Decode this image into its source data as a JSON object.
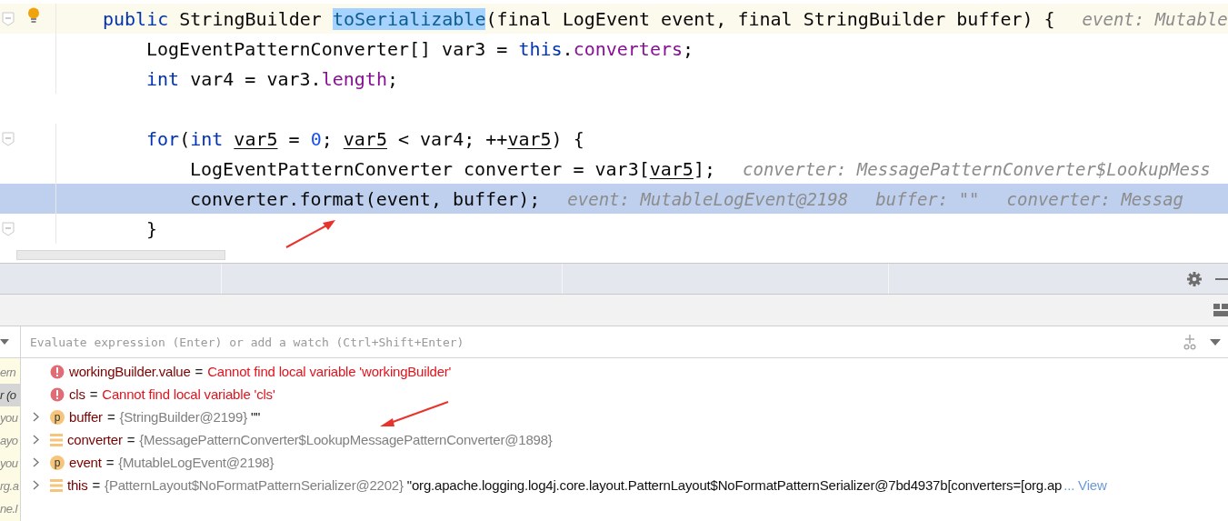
{
  "editor": {
    "lines": [
      {
        "fold": true,
        "bulb": true,
        "caret_line": true,
        "execution_point": false,
        "gap_before": false,
        "tokens": [
          {
            "text": "public",
            "kind": "keyword"
          },
          {
            "text": " StringBuilder ",
            "kind": "plain"
          },
          {
            "text": "toSerializable",
            "kind": "selection"
          },
          {
            "text": "(final LogEvent event, final StringBuilder buffer) {",
            "kind": "plain"
          }
        ],
        "hints": [
          "event: Mutable"
        ],
        "children": [
          {
            "fold": false,
            "bulb": false,
            "caret_line": false,
            "execution_point": false,
            "gap_before": false,
            "tokens": [
              {
                "text": "LogEventPatternConverter[] var3 = ",
                "kind": "plain"
              },
              {
                "text": "this",
                "kind": "keyword"
              },
              {
                "text": ".",
                "kind": "plain"
              },
              {
                "text": "converters",
                "kind": "field"
              },
              {
                "text": ";",
                "kind": "plain"
              }
            ]
          },
          {
            "fold": false,
            "bulb": false,
            "caret_line": false,
            "execution_point": false,
            "gap_before": false,
            "tokens": [
              {
                "text": "int",
                "kind": "keyword"
              },
              {
                "text": " var4 = var3.",
                "kind": "plain"
              },
              {
                "text": "length",
                "kind": "field"
              },
              {
                "text": ";",
                "kind": "plain"
              }
            ]
          },
          {
            "fold": true,
            "bulb": false,
            "caret_line": false,
            "execution_point": false,
            "gap_before": true,
            "tokens": [
              {
                "text": "for",
                "kind": "keyword"
              },
              {
                "text": "(",
                "kind": "plain"
              },
              {
                "text": "int ",
                "kind": "keyword"
              },
              {
                "text": "var5",
                "kind": "reassigned"
              },
              {
                "text": " = ",
                "kind": "plain"
              },
              {
                "text": "0",
                "kind": "number"
              },
              {
                "text": "; ",
                "kind": "plain"
              },
              {
                "text": "var5",
                "kind": "reassigned"
              },
              {
                "text": " < var4; ++",
                "kind": "plain"
              },
              {
                "text": "var5",
                "kind": "reassigned"
              },
              {
                "text": ") {",
                "kind": "plain"
              }
            ],
            "children": [
              {
                "fold": false,
                "bulb": false,
                "caret_line": false,
                "execution_point": false,
                "gap_before": false,
                "tokens": [
                  {
                    "text": "LogEventPatternConverter converter = var3[",
                    "kind": "plain"
                  },
                  {
                    "text": "var5",
                    "kind": "reassigned"
                  },
                  {
                    "text": "];",
                    "kind": "plain"
                  }
                ],
                "hints": [
                  "converter: MessagePatternConverter$LookupMess"
                ]
              },
              {
                "fold": false,
                "bulb": false,
                "caret_line": false,
                "execution_point": true,
                "gap_before": false,
                "tokens": [
                  {
                    "text": "converter.format(event, buffer);",
                    "kind": "plain"
                  }
                ],
                "hints": [
                  "event: MutableLogEvent@2198",
                  "buffer: \"\"",
                  "converter: Messag"
                ]
              }
            ]
          },
          {
            "fold": true,
            "bulb": false,
            "caret_line": false,
            "execution_point": false,
            "gap_before": false,
            "tokens": [
              {
                "text": "}",
                "kind": "plain"
              }
            ]
          }
        ]
      }
    ]
  },
  "debug_panel": {
    "frames": [
      {
        "text": "ern",
        "selected": false
      },
      {
        "text": "r (o",
        "selected": true
      },
      {
        "text": "you",
        "selected": false
      },
      {
        "text": "ayo",
        "selected": false
      },
      {
        "text": "you",
        "selected": false
      },
      {
        "text": "rg.a",
        "selected": false
      },
      {
        "text": "ne.l",
        "selected": false
      }
    ],
    "watch_field": {
      "placeholder": "Evaluate expression (Enter) or add a watch (Ctrl+Shift+Enter)"
    },
    "variables": [
      {
        "kind": "error",
        "expandable": false,
        "name": "workingBuilder.value",
        "operator": "=",
        "message": "Cannot find local variable 'workingBuilder'"
      },
      {
        "kind": "error",
        "expandable": false,
        "name": "cls",
        "operator": "=",
        "message": "Cannot find local variable 'cls'"
      },
      {
        "kind": "parameter",
        "badge": "p",
        "expandable": true,
        "name": "buffer",
        "operator": "=",
        "type": "{StringBuilder@2199}",
        "value": "\"\""
      },
      {
        "kind": "field",
        "expandable": true,
        "name": "converter",
        "operator": "=",
        "type": "{MessagePatternConverter$LookupMessagePatternConverter@1898}"
      },
      {
        "kind": "parameter",
        "badge": "p",
        "expandable": true,
        "name": "event",
        "operator": "=",
        "type": "{MutableLogEvent@2198}"
      },
      {
        "kind": "field",
        "expandable": true,
        "name": "this",
        "operator": "=",
        "type": "{PatternLayout$NoFormatPatternSerializer@2202}",
        "value": "\"org.apache.logging.log4j.core.layout.PatternLayout$NoFormatPatternSerializer@7bd4937b[converters=[org.ap",
        "link": "... View"
      }
    ]
  }
}
